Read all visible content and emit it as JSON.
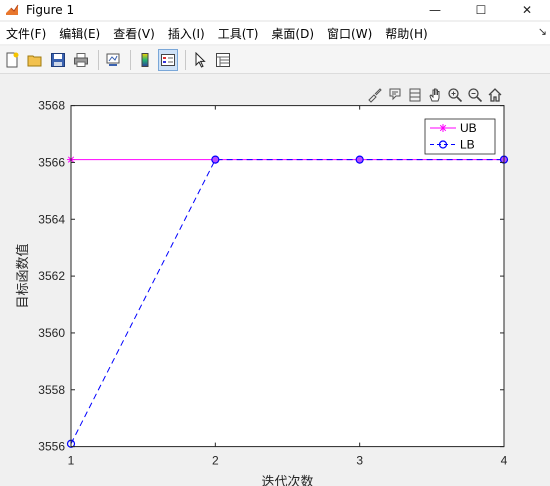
{
  "window": {
    "title": "Figure 1",
    "minimize_glyph": "—",
    "maximize_glyph": "☐",
    "close_glyph": "✕"
  },
  "menu": {
    "items": [
      {
        "label": "文件(F)"
      },
      {
        "label": "编辑(E)"
      },
      {
        "label": "查看(V)"
      },
      {
        "label": "插入(I)"
      },
      {
        "label": "工具(T)"
      },
      {
        "label": "桌面(D)"
      },
      {
        "label": "窗口(W)"
      },
      {
        "label": "帮助(H)"
      }
    ],
    "overflow_glyph": "↘"
  },
  "toolbar": {
    "icons": [
      "new-figure-icon",
      "open-file-icon",
      "save-icon",
      "print-icon",
      "link-plot-icon",
      "colorbar-icon",
      "legend-icon",
      "pointer-icon",
      "property-inspector-icon"
    ]
  },
  "axes_toolbar": {
    "icons": [
      "brush-icon",
      "data-tips-icon",
      "rotate-icon",
      "pan-icon",
      "zoom-in-icon",
      "zoom-out-icon",
      "home-icon"
    ]
  },
  "chart_data": {
    "type": "line",
    "x": [
      1,
      2,
      3,
      4
    ],
    "series": [
      {
        "name": "UB",
        "values": [
          3566.1,
          3566.1,
          3566.1,
          3566.1
        ],
        "color": "#ff00ff",
        "line": "solid",
        "marker": "*"
      },
      {
        "name": "LB",
        "values": [
          3556.1,
          3566.1,
          3566.1,
          3566.1
        ],
        "color": "#0000ff",
        "line": "dashed",
        "marker": "o",
        "marker_face": "#b84dff"
      }
    ],
    "xlabel": "迭代次数",
    "ylabel": "目标函数值",
    "xlim": [
      1,
      4
    ],
    "ylim": [
      3556,
      3568
    ],
    "xticks": [
      "1",
      "2",
      "3",
      "4"
    ],
    "yticks": [
      "3556",
      "3558",
      "3560",
      "3562",
      "3564",
      "3566",
      "3568"
    ],
    "grid": false,
    "legend_position": "top-right"
  }
}
